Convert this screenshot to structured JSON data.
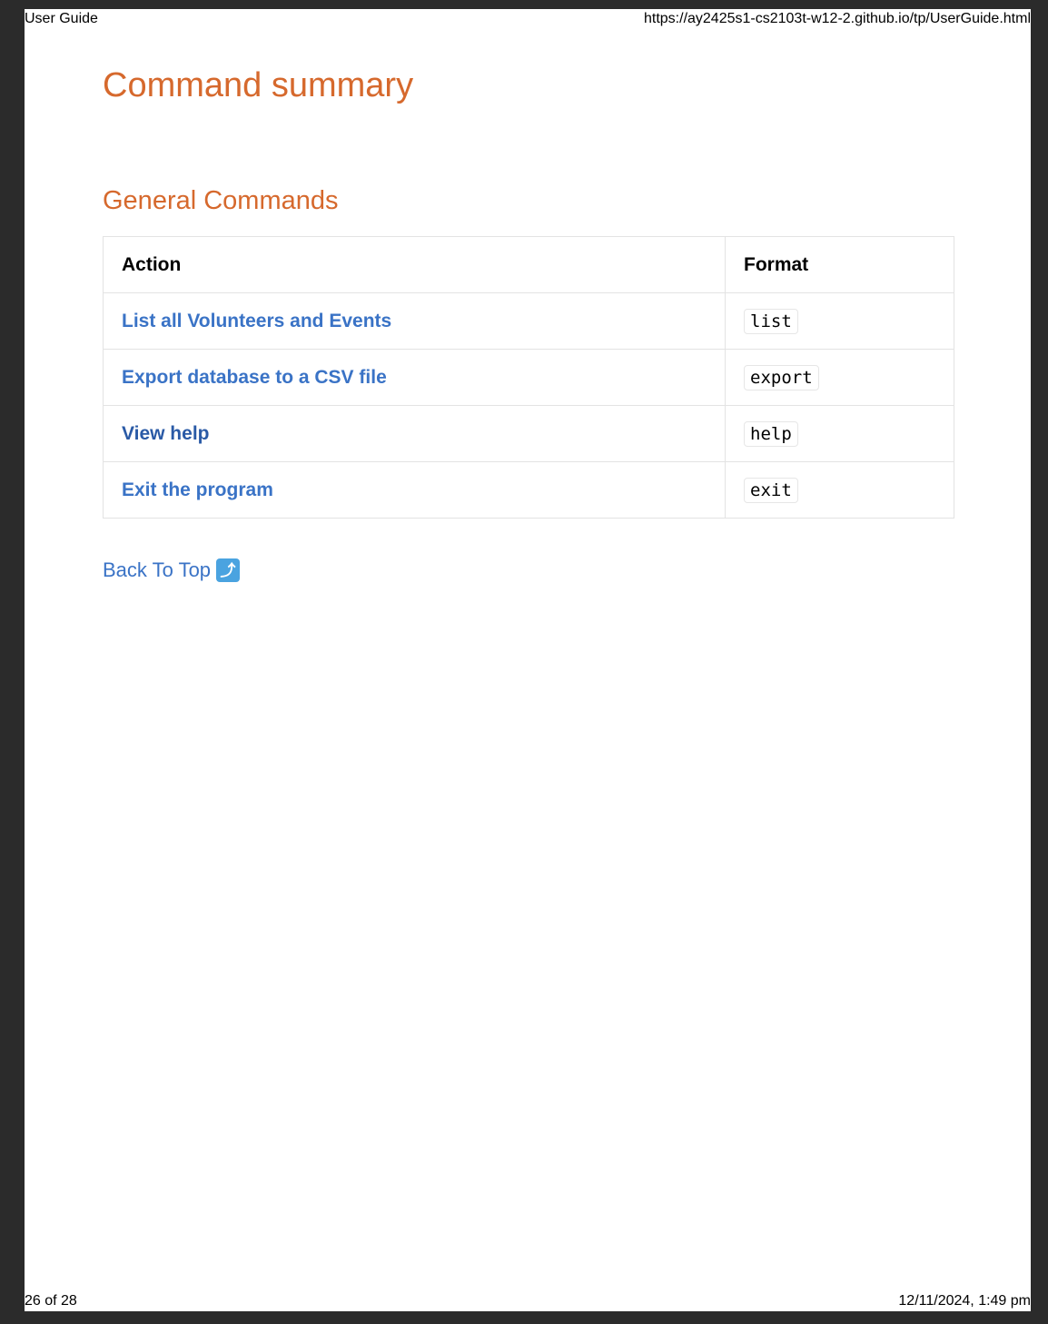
{
  "print_header": {
    "title": "User Guide",
    "url": "https://ay2425s1-cs2103t-w12-2.github.io/tp/UserGuide.html"
  },
  "print_footer": {
    "page": "26 of 28",
    "datetime": "12/11/2024, 1:49 pm"
  },
  "heading": "Command summary",
  "section": {
    "title": "General Commands",
    "table": {
      "headers": [
        "Action",
        "Format"
      ],
      "rows": [
        {
          "action": "List all Volunteers and Events",
          "format": "list"
        },
        {
          "action": "Export database to a CSV file",
          "format": "export"
        },
        {
          "action": "View help",
          "format": "help"
        },
        {
          "action": "Exit the program",
          "format": "exit"
        }
      ]
    }
  },
  "back_to_top": {
    "label": "Back To Top",
    "icon": "arrow-up-right-icon",
    "icon_glyph": "⤴"
  },
  "colors": {
    "heading": "#d6692d",
    "link": "#3a73c6",
    "link_visited": "#2a5aa6"
  }
}
